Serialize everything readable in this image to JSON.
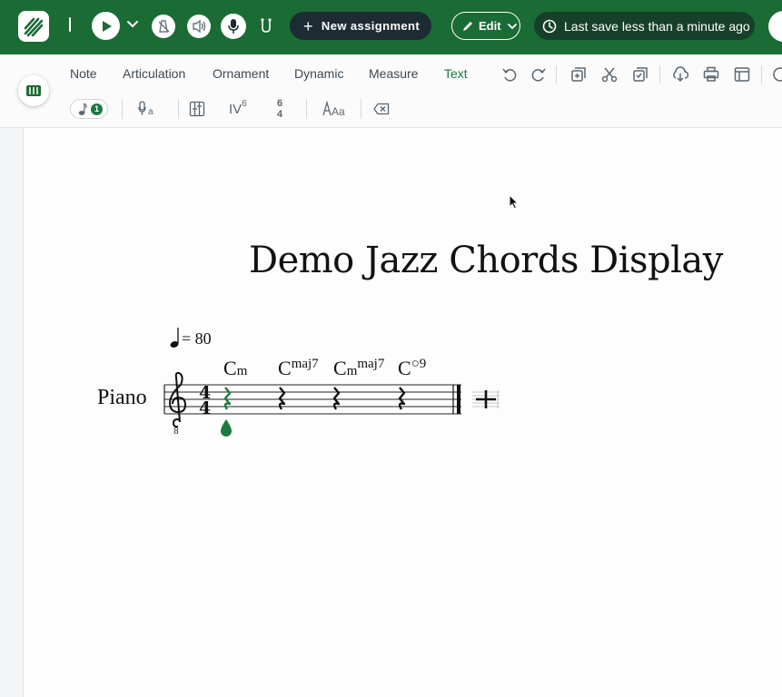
{
  "topbar": {
    "new_assignment_label": "New assignment",
    "edit_label": "Edit",
    "save_status": "Last save less than a minute ago",
    "icons": [
      "logo-icon",
      "play-icon",
      "chevron-down-icon",
      "metronome-icon",
      "speaker-icon",
      "microphone-icon",
      "tuning-icon",
      "plus-icon",
      "pencil-icon",
      "clock-icon"
    ]
  },
  "tabs": [
    {
      "label": "Note",
      "active": false
    },
    {
      "label": "Articulation",
      "active": false
    },
    {
      "label": "Ornament",
      "active": false
    },
    {
      "label": "Dynamic",
      "active": false
    },
    {
      "label": "Measure",
      "active": false
    },
    {
      "label": "Text",
      "active": true
    }
  ],
  "toolbar_icons": [
    "undo-icon",
    "redo-icon",
    "duplicate-icon",
    "scissors-icon",
    "paste-icon",
    "cloud-download-icon",
    "print-icon",
    "layout-icon"
  ],
  "subtoolbar": {
    "note_count": "1",
    "roman_numeral": "IV",
    "roman_superscript": "6",
    "figured_top": "6",
    "figured_bottom": "4",
    "icons": [
      "note-icon",
      "lyrics-icon",
      "chord-grid-icon",
      "text-style-icon",
      "delete-backspace-icon"
    ]
  },
  "score": {
    "title": "Demo Jazz Chords Display",
    "tempo_text": "= 80",
    "instrument": "Piano",
    "time_signature_top": "4",
    "time_signature_bottom": "4",
    "chords": [
      {
        "root": "C",
        "quality": "m",
        "superscript": ""
      },
      {
        "root": "C",
        "quality": "",
        "superscript": "maj7"
      },
      {
        "root": "C",
        "quality": "m",
        "superscript": "maj7"
      },
      {
        "root": "C",
        "quality": "",
        "superscript": "○9"
      }
    ],
    "accent_color": "#1b7a3e"
  },
  "colors": {
    "brand": "#1b6b35",
    "active_tab": "#1b7a3e",
    "dark_pill": "#1d2b33"
  }
}
